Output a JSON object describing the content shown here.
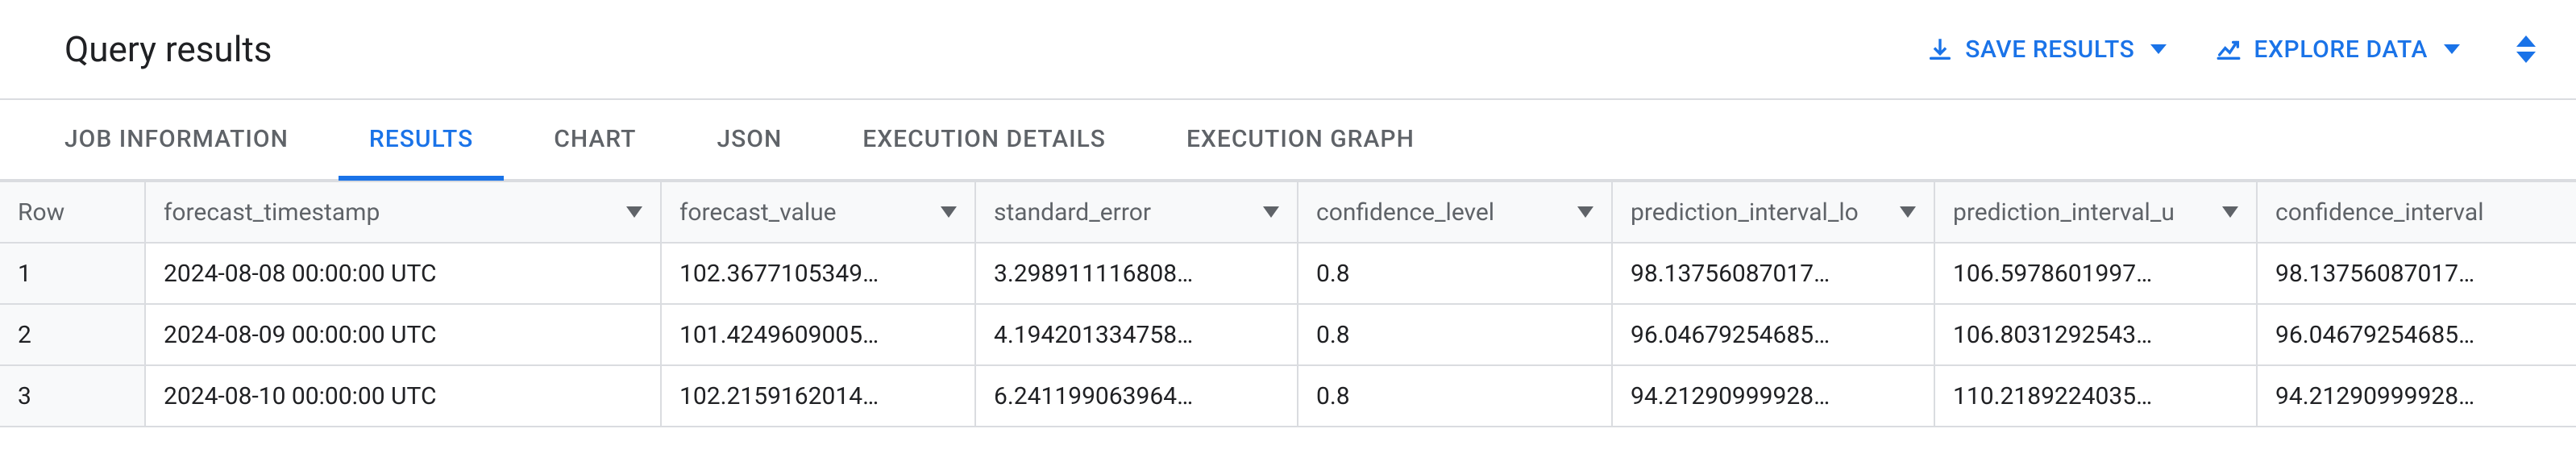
{
  "header": {
    "title": "Query results",
    "save_label": "SAVE RESULTS",
    "explore_label": "EXPLORE DATA"
  },
  "tabs": [
    {
      "label": "JOB INFORMATION"
    },
    {
      "label": "RESULTS"
    },
    {
      "label": "CHART"
    },
    {
      "label": "JSON"
    },
    {
      "label": "EXECUTION DETAILS"
    },
    {
      "label": "EXECUTION GRAPH"
    }
  ],
  "columns": {
    "row": "Row",
    "forecast_timestamp": "forecast_timestamp",
    "forecast_value": "forecast_value",
    "standard_error": "standard_error",
    "confidence_level": "confidence_level",
    "prediction_interval_lower": "prediction_interval_lo",
    "prediction_interval_upper": "prediction_interval_u",
    "confidence_interval": "confidence_interval"
  },
  "rows": [
    {
      "n": "1",
      "ts": "2024-08-08 00:00:00 UTC",
      "fv": "102.3677105349…",
      "se": "3.298911116808…",
      "cl": "0.8",
      "pl": "98.13756087017…",
      "pu": "106.5978601997…",
      "ci": "98.13756087017…"
    },
    {
      "n": "2",
      "ts": "2024-08-09 00:00:00 UTC",
      "fv": "101.4249609005…",
      "se": "4.194201334758…",
      "cl": "0.8",
      "pl": "96.04679254685…",
      "pu": "106.8031292543…",
      "ci": "96.04679254685…"
    },
    {
      "n": "3",
      "ts": "2024-08-10 00:00:00 UTC",
      "fv": "102.2159162014…",
      "se": "6.241199063964…",
      "cl": "0.8",
      "pl": "94.21290999928…",
      "pu": "110.2189224035…",
      "ci": "94.21290999928…"
    }
  ]
}
